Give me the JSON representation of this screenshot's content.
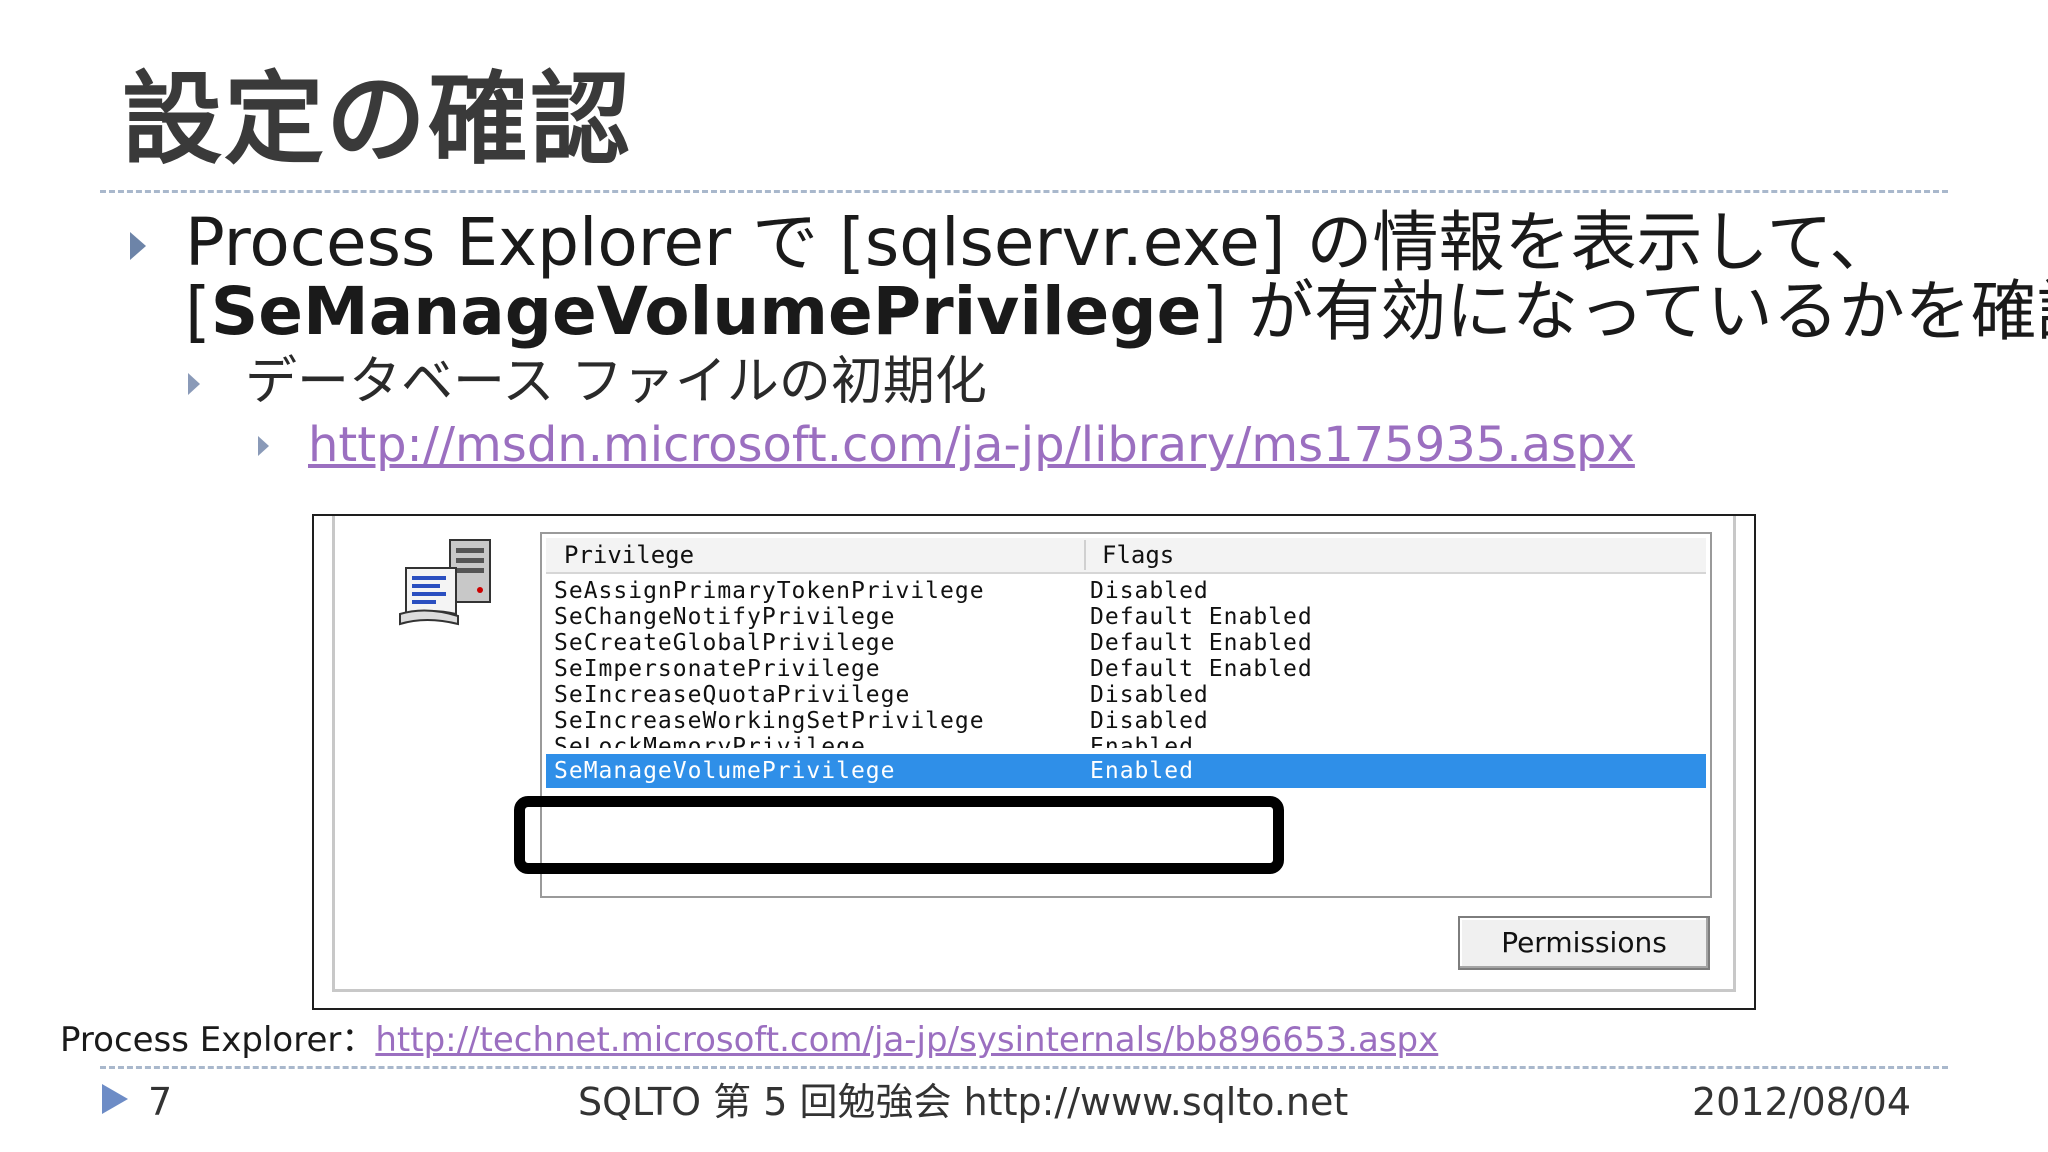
{
  "slide": {
    "title": "設定の確認",
    "bullet_line1": "Process Explorer で [sqlservr.exe] の情報を表示して、",
    "bullet_line2_open": "[",
    "bullet_line2_bold": "SeManageVolumePrivilege",
    "bullet_line2_rest": "] が有効になっているかを確認",
    "sub_bullet": "データベース ファイルの初期化",
    "sub_sub_link": "http://msdn.microsoft.com/ja-jp/library/ms175935.aspx"
  },
  "privileges_panel": {
    "columns": [
      "Privilege",
      "Flags"
    ],
    "rows": [
      {
        "privilege": "SeAssignPrimaryTokenPrivilege",
        "flags": "Disabled"
      },
      {
        "privilege": "SeChangeNotifyPrivilege",
        "flags": "Default Enabled"
      },
      {
        "privilege": "SeCreateGlobalPrivilege",
        "flags": "Default Enabled"
      },
      {
        "privilege": "SeImpersonatePrivilege",
        "flags": "Default Enabled"
      },
      {
        "privilege": "SeIncreaseQuotaPrivilege",
        "flags": "Disabled"
      },
      {
        "privilege": "SeIncreaseWorkingSetPrivilege",
        "flags": "Disabled"
      },
      {
        "privilege": "SeLockMemoryPrivilege",
        "flags": "Enabled"
      },
      {
        "privilege": "SeManageVolumePrivilege",
        "flags": "Enabled"
      }
    ],
    "selected_row": "SeManageVolumePrivilege",
    "permissions_button": "Permissions",
    "selection_color": "#2f8fe8"
  },
  "source_note": {
    "label": "Process Explorer：",
    "link": "http://technet.microsoft.com/ja-jp/sysinternals/bb896653.aspx"
  },
  "footer": {
    "page_number": "7",
    "center_text": "SQLTO 第 5 回勉強会 http://www.sqlto.net",
    "date": "2012/08/04"
  },
  "colors": {
    "title": "#3a3a3a",
    "link": "#9b6fc0",
    "bullet": "#6d84a8",
    "divider": "#a9b8cc"
  }
}
